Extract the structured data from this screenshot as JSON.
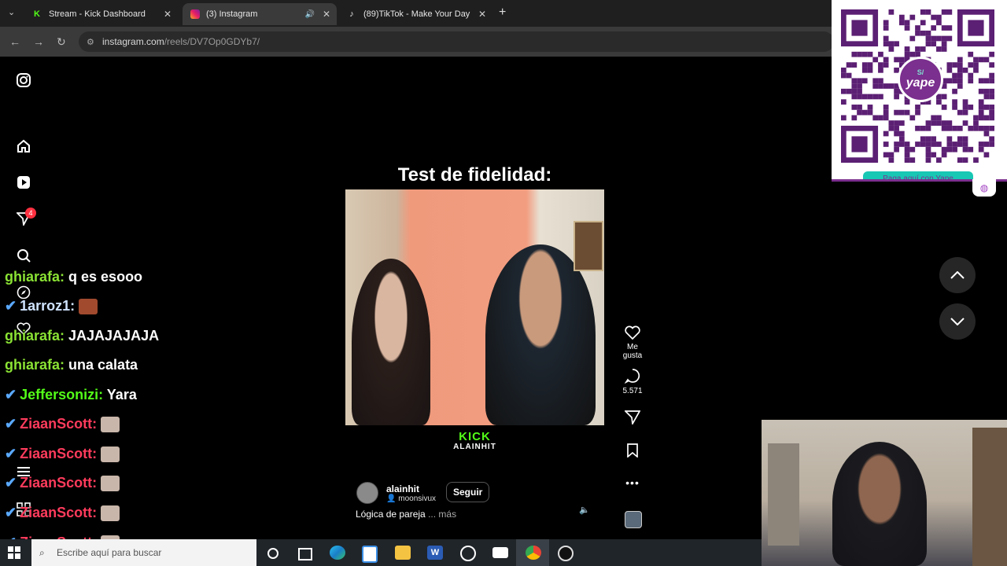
{
  "browser": {
    "tabs": [
      {
        "title": "Stream - Kick Dashboard",
        "icon": "kick-icon",
        "active": false
      },
      {
        "title": "(3) Instagram",
        "icon": "instagram-icon",
        "active": true
      },
      {
        "title": "(89)TikTok - Make Your Day",
        "icon": "tiktok-icon",
        "active": false
      }
    ],
    "url_host": "instagram.com",
    "url_path": "/reels/DV7Op0GDYb7/"
  },
  "sidebar": {
    "notification_count": "4"
  },
  "reel": {
    "overlay_title": "Test de fidelidad:",
    "kick_logo": "KICK",
    "kick_channel": "ALAINHIT",
    "author": "alainhit",
    "collab": "moonsivux",
    "follow_label": "Seguir",
    "caption": "Lógica de pareja",
    "more_label": "... más"
  },
  "actions": {
    "like_label": "Me gusta",
    "comments_count": "5.571"
  },
  "chat": [
    {
      "user": "ghiarafa",
      "user_color": "#8ae234",
      "text": "q es esooo"
    },
    {
      "user": "1arroz1",
      "user_color": "#cfe3ff",
      "text": ""
    },
    {
      "user": "ghiarafa",
      "user_color": "#8ae234",
      "text": "JAJAJAJAJA"
    },
    {
      "user": "ghiarafa",
      "user_color": "#8ae234",
      "text": "una calata"
    },
    {
      "user": "Jeffersonizi",
      "user_color": "#53fc18",
      "text": "Yara"
    },
    {
      "user": "ZiaanScott",
      "user_color": "#ff3b5c",
      "text": ""
    },
    {
      "user": "ZiaanScott",
      "user_color": "#ff3b5c",
      "text": ""
    },
    {
      "user": "ZiaanScott",
      "user_color": "#ff3b5c",
      "text": ""
    },
    {
      "user": "ZiaanScott",
      "user_color": "#ff3b5c",
      "text": ""
    },
    {
      "user": "ZiaanScott",
      "user_color": "#ff3b5c",
      "text": ""
    }
  ],
  "qr": {
    "brand": "yape",
    "currency": "S/",
    "footer": "Paga aquí con Yape"
  },
  "taskbar": {
    "search_placeholder": "Escribe aquí para buscar"
  }
}
